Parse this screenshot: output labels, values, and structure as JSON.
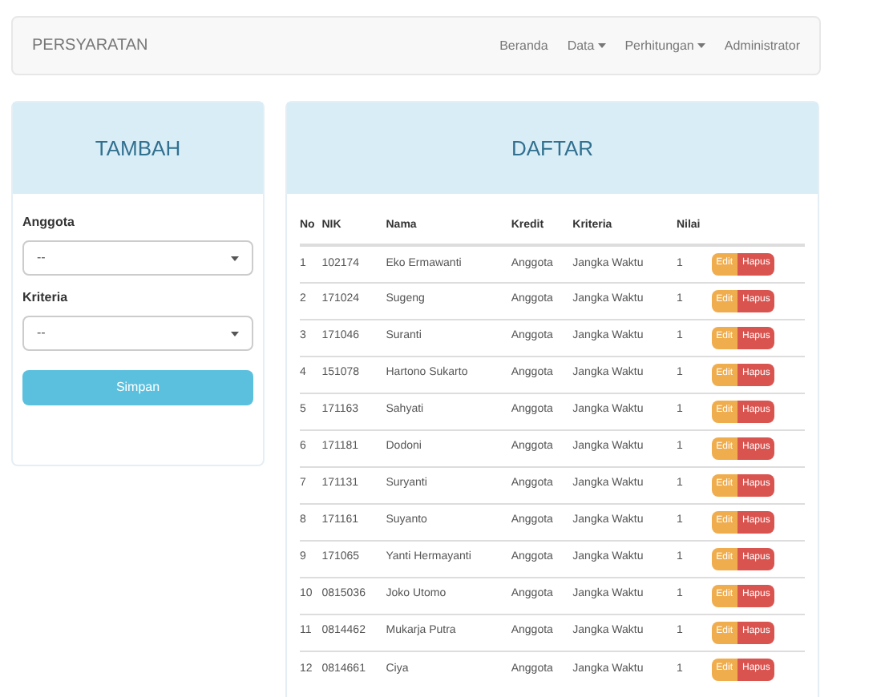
{
  "navbar": {
    "brand": "PERSYARATAN",
    "items": [
      {
        "label": "Beranda",
        "dropdown": false
      },
      {
        "label": "Data",
        "dropdown": true
      },
      {
        "label": "Perhitungan",
        "dropdown": true
      },
      {
        "label": "Administrator",
        "dropdown": false
      }
    ]
  },
  "add_panel": {
    "title": "TAMBAH",
    "fields": [
      {
        "label": "Anggota",
        "value": "--"
      },
      {
        "label": "Kriteria",
        "value": "--"
      }
    ],
    "submit": "Simpan"
  },
  "list_panel": {
    "title": "DAFTAR",
    "columns": [
      "No",
      "NIK",
      "Nama",
      "Kredit",
      "Kriteria",
      "Nilai"
    ],
    "rows": [
      {
        "cells": [
          "1",
          "102174",
          "Eko Ermawanti",
          "Anggota",
          "Jangka Waktu",
          "1"
        ],
        "actions": [
          "Edit",
          "Hapus"
        ]
      },
      {
        "cells": [
          "2",
          "171024",
          "Sugeng",
          "Anggota",
          "Jangka Waktu",
          "1"
        ],
        "actions": [
          "Edit",
          "Hapus"
        ]
      },
      {
        "cells": [
          "3",
          "171046",
          "Suranti",
          "Anggota",
          "Jangka Waktu",
          "1"
        ],
        "actions": [
          "Edit",
          "Hapus"
        ]
      },
      {
        "cells": [
          "4",
          "151078",
          "Hartono Sukarto",
          "Anggota",
          "Jangka Waktu",
          "1"
        ],
        "actions": [
          "Edit",
          "Hapus"
        ]
      },
      {
        "cells": [
          "5",
          "171163",
          "Sahyati",
          "Anggota",
          "Jangka Waktu",
          "1"
        ],
        "actions": [
          "Edit",
          "Hapus"
        ]
      },
      {
        "cells": [
          "6",
          "171181",
          "Dodoni",
          "Anggota",
          "Jangka Waktu",
          "1"
        ],
        "actions": [
          "Edit",
          "Hapus"
        ]
      },
      {
        "cells": [
          "7",
          "171131",
          "Suryanti",
          "Anggota",
          "Jangka Waktu",
          "1"
        ],
        "actions": [
          "Edit",
          "Hapus"
        ]
      },
      {
        "cells": [
          "8",
          "171161",
          "Suyanto",
          "Anggota",
          "Jangka Waktu",
          "1"
        ],
        "actions": [
          "Edit",
          "Hapus"
        ]
      },
      {
        "cells": [
          "9",
          "171065",
          "Yanti Hermayanti",
          "Anggota",
          "Jangka Waktu",
          "1"
        ],
        "actions": [
          "Edit",
          "Hapus"
        ]
      },
      {
        "cells": [
          "10",
          "0815036",
          "Joko Utomo",
          "Anggota",
          "Jangka Waktu",
          "1"
        ],
        "actions": [
          "Edit",
          "Hapus"
        ]
      },
      {
        "cells": [
          "11",
          "0814462",
          "Mukarja Putra",
          "Anggota",
          "Jangka Waktu",
          "1"
        ],
        "actions": [
          "Edit",
          "Hapus"
        ]
      },
      {
        "cells": [
          "12",
          "0814661",
          "Ciya",
          "Anggota",
          "Jangka Waktu",
          "1"
        ],
        "actions": [
          "Edit",
          "Hapus"
        ]
      }
    ]
  }
}
